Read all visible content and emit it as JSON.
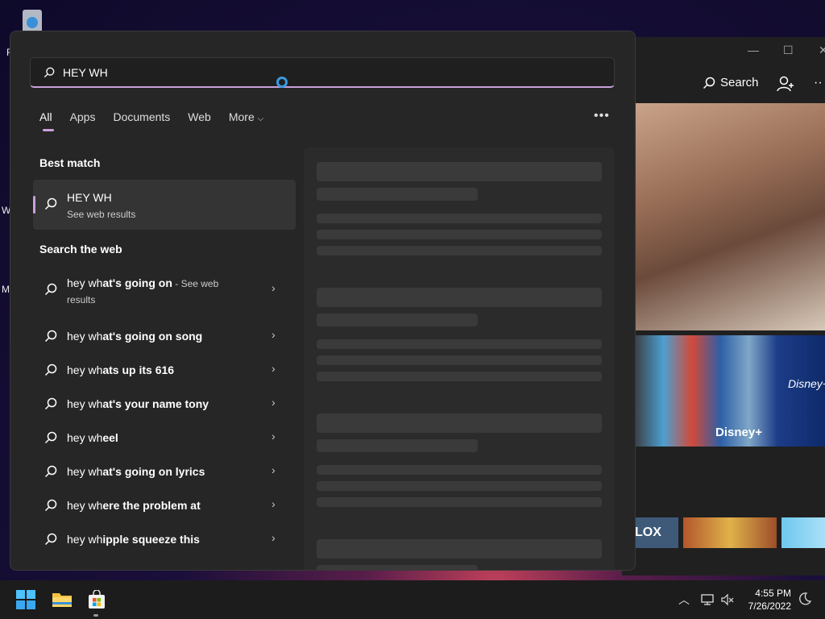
{
  "desktop": {
    "fragments": [
      "R",
      "W",
      "M"
    ]
  },
  "store_window": {
    "search_label": "Search",
    "disney_label": "Disney+",
    "disney_logo": "Disney+",
    "tile_text": "LOX"
  },
  "search": {
    "query": "HEY WH",
    "tabs": [
      "All",
      "Apps",
      "Documents",
      "Web",
      "More"
    ],
    "best_match_heading": "Best match",
    "best_match": {
      "title": "HEY WH",
      "subtitle": "See web results"
    },
    "web_heading": "Search the web",
    "web_results": [
      {
        "prefix": "hey wh",
        "rest": "at's going on",
        "suffix": " - See web",
        "line2": "results"
      },
      {
        "prefix": "hey wh",
        "rest": "at's going on song"
      },
      {
        "prefix": "hey wh",
        "rest": "ats up its 616"
      },
      {
        "prefix": "hey wh",
        "rest": "at's your name tony"
      },
      {
        "prefix": "hey wh",
        "rest": "eel"
      },
      {
        "prefix": "hey wh",
        "rest": "at's going on lyrics"
      },
      {
        "prefix": "hey wh",
        "rest": "ere the problem at"
      },
      {
        "prefix": "hey wh",
        "rest": "ipple squeeze this"
      }
    ]
  },
  "taskbar": {
    "time": "4:55 PM",
    "date": "7/26/2022"
  },
  "colors": {
    "accent": "#c9a0dc",
    "cortana": "#3a9ae0",
    "panel_bg": "#262626"
  }
}
